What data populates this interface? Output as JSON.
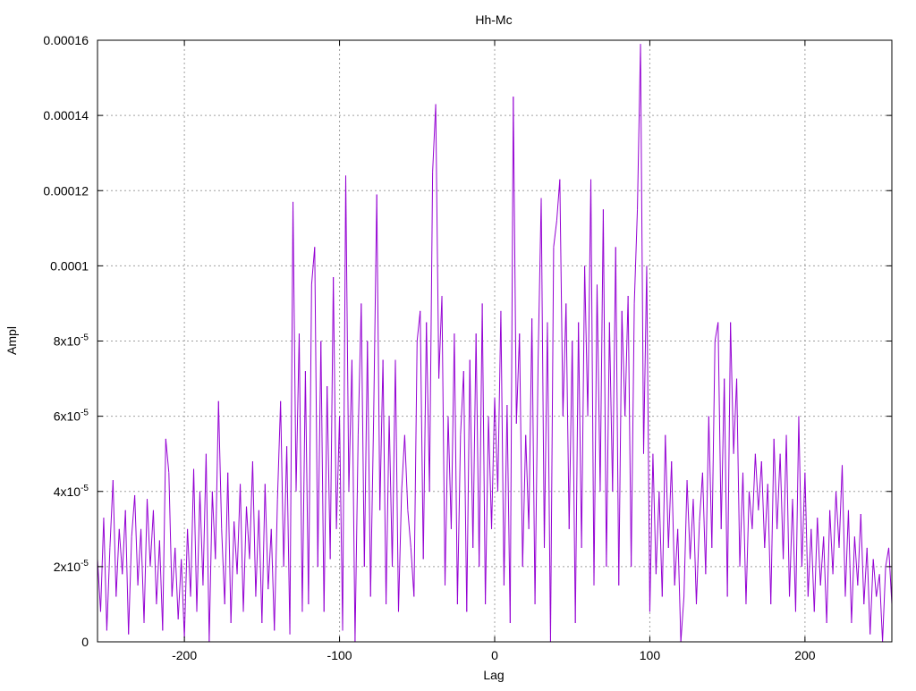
{
  "chart_data": {
    "type": "line",
    "title": "Hh-Mc",
    "xlabel": "Lag",
    "ylabel": "Ampl",
    "xlim": [
      -256,
      256
    ],
    "ylim": [
      0,
      0.00016
    ],
    "grid": true,
    "legend": "none",
    "x_ticks": [
      {
        "value": -200,
        "label": "-200"
      },
      {
        "value": -100,
        "label": "-100"
      },
      {
        "value": 0,
        "label": "0"
      },
      {
        "value": 100,
        "label": "100"
      },
      {
        "value": 200,
        "label": "200"
      }
    ],
    "y_ticks": [
      {
        "value": 0,
        "label": "0",
        "sup": ""
      },
      {
        "value": 2e-05,
        "label": "2x10",
        "sup": "-5"
      },
      {
        "value": 4e-05,
        "label": "4x10",
        "sup": "-5"
      },
      {
        "value": 6e-05,
        "label": "6x10",
        "sup": "-5"
      },
      {
        "value": 8e-05,
        "label": "8x10",
        "sup": "-5"
      },
      {
        "value": 0.0001,
        "label": "0.0001",
        "sup": ""
      },
      {
        "value": 0.00012,
        "label": "0.00012",
        "sup": ""
      },
      {
        "value": 0.00014,
        "label": "0.00014",
        "sup": ""
      },
      {
        "value": 0.00016,
        "label": "0.00016",
        "sup": ""
      }
    ],
    "series": [
      {
        "color": "#9400d3",
        "points": [
          [
            -256,
            2.2e-05
          ],
          [
            -254,
            8e-06
          ],
          [
            -252,
            3.3e-05
          ],
          [
            -250,
            3e-06
          ],
          [
            -248,
            2.5e-05
          ],
          [
            -246,
            4.3e-05
          ],
          [
            -244,
            1.2e-05
          ],
          [
            -242,
            3e-05
          ],
          [
            -240,
            1.8e-05
          ],
          [
            -238,
            3.5e-05
          ],
          [
            -236,
            2e-06
          ],
          [
            -234,
            2.8e-05
          ],
          [
            -232,
            3.9e-05
          ],
          [
            -230,
            1.5e-05
          ],
          [
            -228,
            3e-05
          ],
          [
            -226,
            5e-06
          ],
          [
            -224,
            3.8e-05
          ],
          [
            -222,
            2e-05
          ],
          [
            -220,
            3.5e-05
          ],
          [
            -218,
            1e-05
          ],
          [
            -216,
            2.7e-05
          ],
          [
            -214,
            3e-06
          ],
          [
            -212,
            5.4e-05
          ],
          [
            -210,
            4.5e-05
          ],
          [
            -208,
            1.2e-05
          ],
          [
            -206,
            2.5e-05
          ],
          [
            -204,
            6e-06
          ],
          [
            -202,
            2.2e-05
          ],
          [
            -200,
            1e-06
          ],
          [
            -198,
            3e-05
          ],
          [
            -196,
            1.2e-05
          ],
          [
            -194,
            4.6e-05
          ],
          [
            -192,
            8e-06
          ],
          [
            -190,
            4e-05
          ],
          [
            -188,
            1.5e-05
          ],
          [
            -186,
            5e-05
          ],
          [
            -184,
            0.0
          ],
          [
            -182,
            4e-05
          ],
          [
            -180,
            2.2e-05
          ],
          [
            -178,
            6.4e-05
          ],
          [
            -176,
            3e-05
          ],
          [
            -174,
            1e-05
          ],
          [
            -172,
            4.5e-05
          ],
          [
            -170,
            5e-06
          ],
          [
            -168,
            3.2e-05
          ],
          [
            -166,
            1.8e-05
          ],
          [
            -164,
            4.2e-05
          ],
          [
            -162,
            8e-06
          ],
          [
            -160,
            3.6e-05
          ],
          [
            -158,
            2.2e-05
          ],
          [
            -156,
            4.8e-05
          ],
          [
            -154,
            1.2e-05
          ],
          [
            -152,
            3.5e-05
          ],
          [
            -150,
            5e-06
          ],
          [
            -148,
            4.2e-05
          ],
          [
            -146,
            1.4e-05
          ],
          [
            -144,
            3e-05
          ],
          [
            -142,
            3e-06
          ],
          [
            -140,
            3.8e-05
          ],
          [
            -138,
            6.4e-05
          ],
          [
            -136,
            2e-05
          ],
          [
            -134,
            5.2e-05
          ],
          [
            -132,
            2e-06
          ],
          [
            -130,
            0.000117
          ],
          [
            -128,
            4e-05
          ],
          [
            -126,
            8.2e-05
          ],
          [
            -124,
            8e-06
          ],
          [
            -122,
            7.2e-05
          ],
          [
            -120,
            1e-05
          ],
          [
            -118,
            9.5e-05
          ],
          [
            -116,
            0.000105
          ],
          [
            -114,
            2e-05
          ],
          [
            -112,
            8e-05
          ],
          [
            -110,
            8e-06
          ],
          [
            -108,
            6.8e-05
          ],
          [
            -106,
            2.2e-05
          ],
          [
            -104,
            9.7e-05
          ],
          [
            -102,
            3e-05
          ],
          [
            -100,
            6e-05
          ],
          [
            -98,
            3e-06
          ],
          [
            -96,
            0.000124
          ],
          [
            -94,
            4e-05
          ],
          [
            -92,
            7.5e-05
          ],
          [
            -90,
            0.0
          ],
          [
            -88,
            5.5e-05
          ],
          [
            -86,
            9e-05
          ],
          [
            -84,
            2e-05
          ],
          [
            -82,
            8e-05
          ],
          [
            -80,
            1.2e-05
          ],
          [
            -78,
            6e-05
          ],
          [
            -76,
            0.000119
          ],
          [
            -74,
            3.5e-05
          ],
          [
            -72,
            7.5e-05
          ],
          [
            -70,
            1e-05
          ],
          [
            -68,
            6e-05
          ],
          [
            -66,
            2e-05
          ],
          [
            -64,
            7.5e-05
          ],
          [
            -62,
            8e-06
          ],
          [
            -60,
            4e-05
          ],
          [
            -58,
            5.5e-05
          ],
          [
            -56,
            3.5e-05
          ],
          [
            -54,
            2.5e-05
          ],
          [
            -52,
            1.2e-05
          ],
          [
            -50,
            8e-05
          ],
          [
            -48,
            8.8e-05
          ],
          [
            -46,
            2.2e-05
          ],
          [
            -44,
            8.5e-05
          ],
          [
            -42,
            4e-05
          ],
          [
            -40,
            0.000125
          ],
          [
            -38,
            0.000143
          ],
          [
            -36,
            7e-05
          ],
          [
            -34,
            9.2e-05
          ],
          [
            -32,
            1.5e-05
          ],
          [
            -30,
            6e-05
          ],
          [
            -28,
            3e-05
          ],
          [
            -26,
            8.2e-05
          ],
          [
            -24,
            1e-05
          ],
          [
            -22,
            5.5e-05
          ],
          [
            -20,
            7.2e-05
          ],
          [
            -18,
            8e-06
          ],
          [
            -16,
            7.5e-05
          ],
          [
            -14,
            2.5e-05
          ],
          [
            -12,
            8.2e-05
          ],
          [
            -10,
            2e-05
          ],
          [
            -8,
            9e-05
          ],
          [
            -6,
            1e-05
          ],
          [
            -4,
            6e-05
          ],
          [
            -2,
            3e-05
          ],
          [
            0,
            6.5e-05
          ],
          [
            2,
            4e-05
          ],
          [
            4,
            8.8e-05
          ],
          [
            6,
            1.5e-05
          ],
          [
            8,
            6.3e-05
          ],
          [
            10,
            5e-06
          ],
          [
            12,
            0.000145
          ],
          [
            14,
            5.8e-05
          ],
          [
            16,
            8.2e-05
          ],
          [
            18,
            2e-05
          ],
          [
            20,
            5.5e-05
          ],
          [
            22,
            3e-05
          ],
          [
            24,
            8.6e-05
          ],
          [
            26,
            1e-05
          ],
          [
            28,
            7.5e-05
          ],
          [
            30,
            0.000118
          ],
          [
            32,
            2.5e-05
          ],
          [
            34,
            8.5e-05
          ],
          [
            36,
            0.0
          ],
          [
            38,
            0.000105
          ],
          [
            40,
            0.000112
          ],
          [
            42,
            0.000123
          ],
          [
            44,
            6e-05
          ],
          [
            46,
            9e-05
          ],
          [
            48,
            3e-05
          ],
          [
            50,
            8e-05
          ],
          [
            52,
            5e-06
          ],
          [
            54,
            8.5e-05
          ],
          [
            56,
            2.5e-05
          ],
          [
            58,
            0.0001
          ],
          [
            60,
            6e-05
          ],
          [
            62,
            0.000123
          ],
          [
            64,
            1.5e-05
          ],
          [
            66,
            9.5e-05
          ],
          [
            68,
            4e-05
          ],
          [
            70,
            0.000115
          ],
          [
            72,
            2e-05
          ],
          [
            74,
            8.5e-05
          ],
          [
            76,
            4e-05
          ],
          [
            78,
            0.000105
          ],
          [
            80,
            1.5e-05
          ],
          [
            82,
            8.8e-05
          ],
          [
            84,
            6e-05
          ],
          [
            86,
            9.2e-05
          ],
          [
            88,
            2e-05
          ],
          [
            90,
            9e-05
          ],
          [
            92,
            0.000115
          ],
          [
            94,
            0.000159
          ],
          [
            96,
            5e-05
          ],
          [
            98,
            0.0001
          ],
          [
            100,
            8e-06
          ],
          [
            102,
            5e-05
          ],
          [
            104,
            1.8e-05
          ],
          [
            106,
            4e-05
          ],
          [
            108,
            1.2e-05
          ],
          [
            110,
            5.5e-05
          ],
          [
            112,
            2.5e-05
          ],
          [
            114,
            4.8e-05
          ],
          [
            116,
            1.5e-05
          ],
          [
            118,
            3e-05
          ],
          [
            120,
            0.0
          ],
          [
            122,
            1.2e-05
          ],
          [
            124,
            4.3e-05
          ],
          [
            126,
            2.2e-05
          ],
          [
            128,
            3.8e-05
          ],
          [
            130,
            1e-05
          ],
          [
            132,
            3.2e-05
          ],
          [
            134,
            4.5e-05
          ],
          [
            136,
            1.8e-05
          ],
          [
            138,
            6e-05
          ],
          [
            140,
            2.5e-05
          ],
          [
            142,
            8e-05
          ],
          [
            144,
            8.5e-05
          ],
          [
            146,
            3e-05
          ],
          [
            148,
            7e-05
          ],
          [
            150,
            1.2e-05
          ],
          [
            152,
            8.5e-05
          ],
          [
            154,
            5e-05
          ],
          [
            156,
            7e-05
          ],
          [
            158,
            2e-05
          ],
          [
            160,
            4.5e-05
          ],
          [
            162,
            1e-05
          ],
          [
            164,
            4e-05
          ],
          [
            166,
            3e-05
          ],
          [
            168,
            5e-05
          ],
          [
            170,
            3.5e-05
          ],
          [
            172,
            4.8e-05
          ],
          [
            174,
            2.5e-05
          ],
          [
            176,
            4.2e-05
          ],
          [
            178,
            1e-05
          ],
          [
            180,
            5.4e-05
          ],
          [
            182,
            3e-05
          ],
          [
            184,
            5e-05
          ],
          [
            186,
            2.2e-05
          ],
          [
            188,
            5.5e-05
          ],
          [
            190,
            1.2e-05
          ],
          [
            192,
            3.8e-05
          ],
          [
            194,
            8e-06
          ],
          [
            196,
            6e-05
          ],
          [
            198,
            2e-05
          ],
          [
            200,
            4.5e-05
          ],
          [
            202,
            1.2e-05
          ],
          [
            204,
            3e-05
          ],
          [
            206,
            8e-06
          ],
          [
            208,
            3.3e-05
          ],
          [
            210,
            1.5e-05
          ],
          [
            212,
            2.8e-05
          ],
          [
            214,
            5e-06
          ],
          [
            216,
            3.5e-05
          ],
          [
            218,
            1.8e-05
          ],
          [
            220,
            4e-05
          ],
          [
            222,
            2.5e-05
          ],
          [
            224,
            4.7e-05
          ],
          [
            226,
            1.2e-05
          ],
          [
            228,
            3.5e-05
          ],
          [
            230,
            5e-06
          ],
          [
            232,
            2.8e-05
          ],
          [
            234,
            1.5e-05
          ],
          [
            236,
            3.4e-05
          ],
          [
            238,
            1e-05
          ],
          [
            240,
            2.5e-05
          ],
          [
            242,
            2e-06
          ],
          [
            244,
            2.2e-05
          ],
          [
            246,
            1.2e-05
          ],
          [
            248,
            1.8e-05
          ],
          [
            250,
            0.0
          ],
          [
            252,
            2e-05
          ],
          [
            254,
            2.5e-05
          ],
          [
            256,
            1e-05
          ]
        ]
      }
    ]
  }
}
